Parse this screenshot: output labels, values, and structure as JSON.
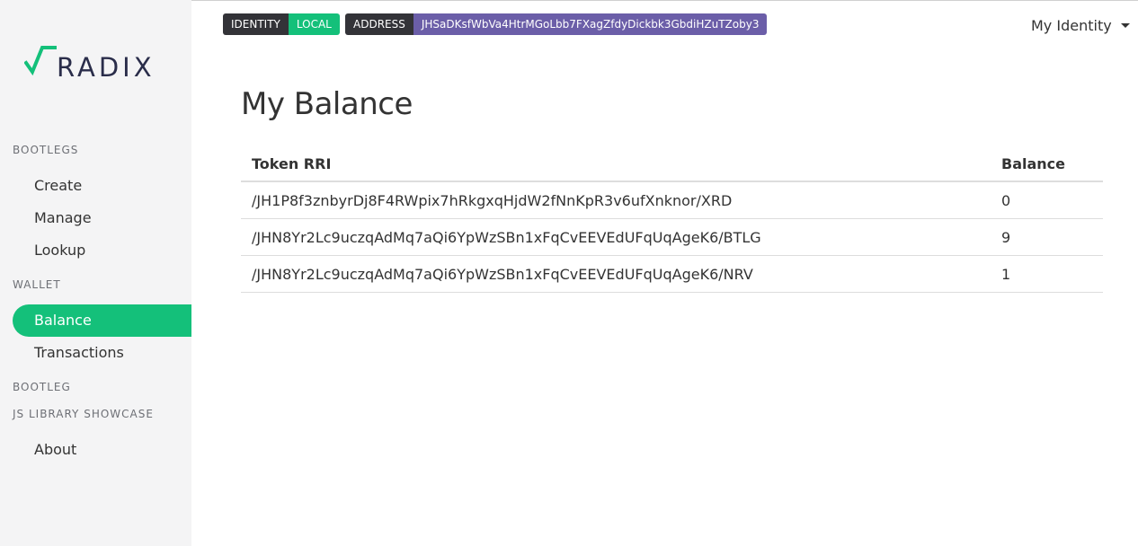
{
  "brand": {
    "name": "RADIX",
    "accent": "#14c07a",
    "dark": "#2a2d4a"
  },
  "sidebar": {
    "sections": [
      {
        "title": "BOOTLEGS"
      },
      {
        "title": "WALLET"
      },
      {
        "title": "BOOTLEG"
      },
      {
        "title": "JS LIBRARY SHOWCASE"
      }
    ],
    "items": [
      {
        "label": "Create"
      },
      {
        "label": "Manage"
      },
      {
        "label": "Lookup"
      },
      {
        "label": "Balance",
        "active": true
      },
      {
        "label": "Transactions"
      },
      {
        "label": "About"
      }
    ]
  },
  "topbar": {
    "identity_key": "IDENTITY",
    "identity_value": "LOCAL",
    "address_key": "ADDRESS",
    "address_value": "JHSaDKsfWbVa4HtrMGoLbb7FXagZfdyDickbk3GbdiHZuTZoby3",
    "identity_menu": "My Identity"
  },
  "main": {
    "title": "My Balance",
    "table": {
      "headers": [
        "Token RRI",
        "Balance"
      ],
      "rows": [
        {
          "rri": "/JH1P8f3znbyrDj8F4RWpix7hRkgxqHjdW2fNnKpR3v6ufXnknor/XRD",
          "balance": "0"
        },
        {
          "rri": "/JHN8Yr2Lc9uczqAdMq7aQi6YpWzSBn1xFqCvEEVEdUFqUqAgeK6/BTLG",
          "balance": "9"
        },
        {
          "rri": "/JHN8Yr2Lc9uczqAdMq7aQi6YpWzSBn1xFqCvEEVEdUFqUqAgeK6/NRV",
          "balance": "1"
        }
      ]
    }
  }
}
